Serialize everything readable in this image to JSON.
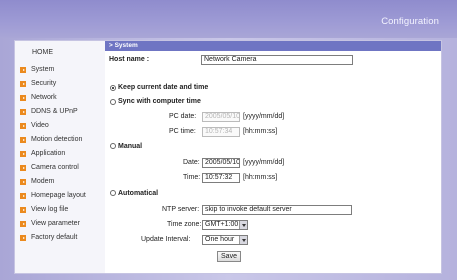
{
  "header": {
    "title": "Configuration"
  },
  "sidebar": {
    "home": "HOME",
    "items": [
      {
        "label": "System"
      },
      {
        "label": "Security"
      },
      {
        "label": "Network"
      },
      {
        "label": "DDNS & UPnP"
      },
      {
        "label": "Video"
      },
      {
        "label": "Motion detection"
      },
      {
        "label": "Application"
      },
      {
        "label": "Camera control"
      },
      {
        "label": "Modem"
      },
      {
        "label": "Homepage layout"
      },
      {
        "label": "View log file"
      },
      {
        "label": "View parameter"
      },
      {
        "label": "Factory default"
      }
    ]
  },
  "section": {
    "title": "> System"
  },
  "host": {
    "label": "Host name :",
    "value": "Network Camera"
  },
  "options": {
    "keep": "Keep current date and time",
    "sync": "Sync with computer time",
    "manual": "Manual",
    "auto": "Automatical"
  },
  "sync_fields": {
    "pc_date_label": "PC date:",
    "pc_date_value": "2005/05/10",
    "pc_date_hint": "[yyyy/mm/dd]",
    "pc_time_label": "PC time:",
    "pc_time_value": "10:57:34",
    "pc_time_hint": "[hh:mm:ss]"
  },
  "manual_fields": {
    "date_label": "Date:",
    "date_value": "2005/05/10",
    "date_hint": "[yyyy/mm/dd]",
    "time_label": "Time:",
    "time_value": "10:57:32",
    "time_hint": "[hh:mm:ss]"
  },
  "auto_fields": {
    "ntp_label": "NTP server:",
    "ntp_value": "skip to invoke default server",
    "tz_label": "Time zone:",
    "tz_value": "GMT+1:00",
    "interval_label": "Update Interval:",
    "interval_value": "One hour"
  },
  "save_label": "Save"
}
